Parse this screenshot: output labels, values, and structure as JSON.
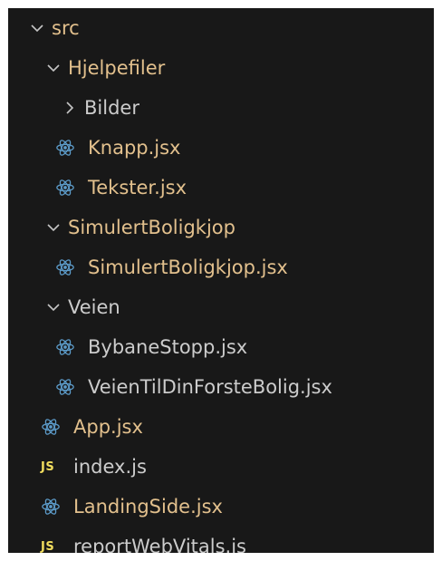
{
  "colors": {
    "background": "#181818",
    "modified_text": "#e2c08d",
    "default_text": "#cccccc",
    "react_icon": "#5c9bc9",
    "js_badge": "#f1dd5e",
    "chevron": "#c5c5c5"
  },
  "tree": {
    "src": {
      "label": "src",
      "expanded": true,
      "icon": "chevron-down-icon"
    },
    "hjelpefiler": {
      "label": "Hjelpefiler",
      "expanded": true,
      "icon": "chevron-down-icon"
    },
    "bilder": {
      "label": "Bilder",
      "expanded": false,
      "icon": "chevron-right-icon"
    },
    "knapp": {
      "label": "Knapp.jsx",
      "icon": "react-icon"
    },
    "tekster": {
      "label": "Tekster.jsx",
      "icon": "react-icon"
    },
    "simulertboligkjop_folder": {
      "label": "SimulertBoligkjop",
      "expanded": true,
      "icon": "chevron-down-icon"
    },
    "simulertboligkjop_file": {
      "label": "SimulertBoligkjop.jsx",
      "icon": "react-icon"
    },
    "veien": {
      "label": "Veien",
      "expanded": true,
      "icon": "chevron-down-icon"
    },
    "bybanestopp": {
      "label": "BybaneStopp.jsx",
      "icon": "react-icon"
    },
    "veientildinforstebolig": {
      "label": "VeienTilDinForsteBolig.jsx",
      "icon": "react-icon"
    },
    "app": {
      "label": "App.jsx",
      "icon": "react-icon"
    },
    "index": {
      "label": "index.js",
      "icon": "js-icon",
      "badge": "JS"
    },
    "landingside": {
      "label": "LandingSide.jsx",
      "icon": "react-icon"
    },
    "reportwebvitals": {
      "label": "reportWebVitals.js",
      "icon": "js-icon",
      "badge": "JS"
    }
  }
}
